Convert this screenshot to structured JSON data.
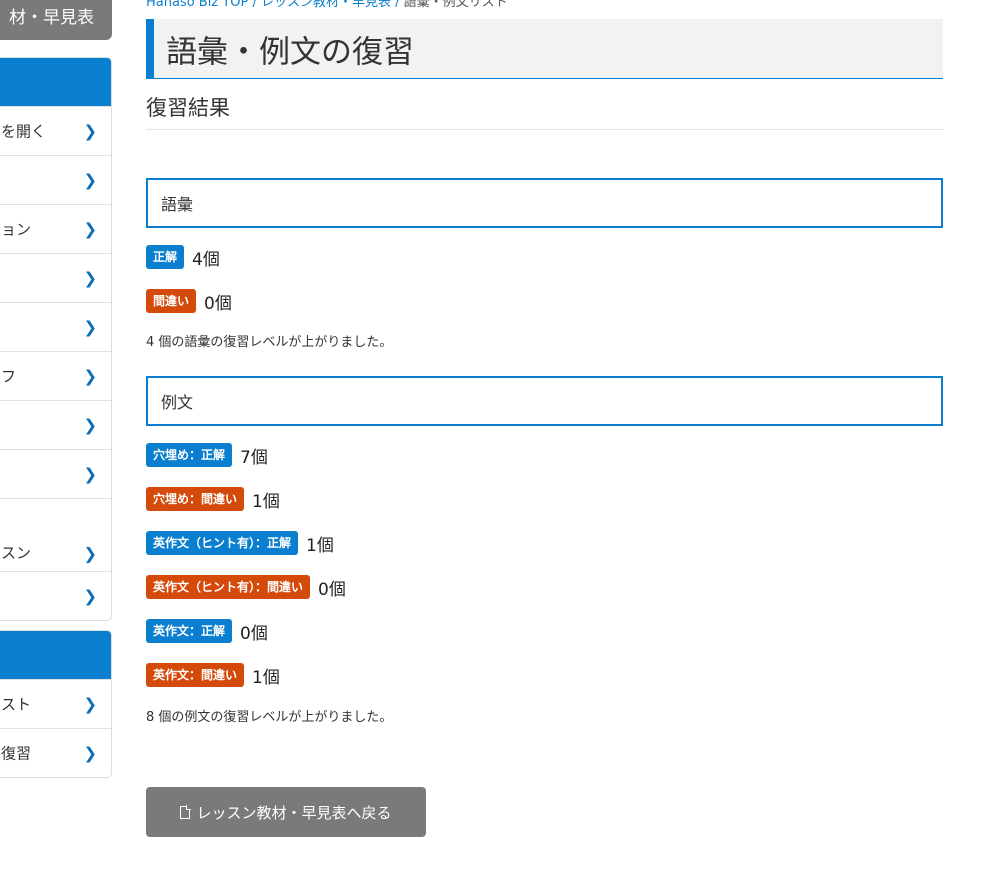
{
  "sidebar": {
    "top_button": "材・早見表",
    "panel1_items": [
      {
        "label": "を開く"
      },
      {
        "label": ""
      },
      {
        "label": "ョン"
      },
      {
        "label": ""
      },
      {
        "label": ""
      },
      {
        "label": "フ"
      },
      {
        "label": ""
      },
      {
        "label": ""
      },
      {
        "label": "スン"
      },
      {
        "label": ""
      }
    ],
    "panel2_items": [
      {
        "label": "スト"
      },
      {
        "label": "復習"
      }
    ]
  },
  "breadcrumb": {
    "trail": "Hanaso Biz TOP / レッスン教材・早見表 / ",
    "current": "語彙・例文リスト"
  },
  "page": {
    "title": "語彙・例文の復習",
    "subtitle": "復習結果"
  },
  "vocab": {
    "heading": "語彙",
    "results": [
      {
        "badge": "正解",
        "count": "4個",
        "kind": "ok"
      },
      {
        "badge": "間違い",
        "count": "0個",
        "kind": "ng"
      }
    ],
    "note": "4 個の語彙の復習レベルが上がりました。"
  },
  "examples": {
    "heading": "例文",
    "results": [
      {
        "badge": "穴埋め：正解",
        "count": "7個",
        "kind": "ok"
      },
      {
        "badge": "穴埋め：間違い",
        "count": "1個",
        "kind": "ng"
      },
      {
        "badge": "英作文（ヒント有）：正解",
        "count": "1個",
        "kind": "ok"
      },
      {
        "badge": "英作文（ヒント有）：間違い",
        "count": "0個",
        "kind": "ng"
      },
      {
        "badge": "英作文：正解",
        "count": "0個",
        "kind": "ok"
      },
      {
        "badge": "英作文：間違い",
        "count": "1個",
        "kind": "ng"
      }
    ],
    "note": "8 個の例文の復習レベルが上がりました。"
  },
  "back_button": {
    "label": "レッスン教材・早見表へ戻る",
    "icon": "document-icon"
  },
  "colors": {
    "primary": "#0b7fcf",
    "danger": "#d44a0a",
    "button_gray": "#7a7a7a"
  }
}
